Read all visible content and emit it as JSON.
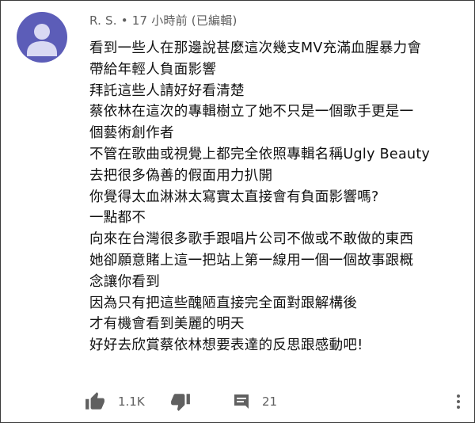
{
  "comment": {
    "author": "R. S.",
    "separator": "•",
    "timestamp": "17 小時前 (已編輯)",
    "lines": [
      "看到一些人在那邊說甚麼這次幾支MV充滿血腥暴力會",
      "帶給年輕人負面影響",
      "拜託這些人請好好看清楚",
      "蔡依林在這次的專輯樹立了她不只是一個歌手更是一",
      "個藝術創作者",
      "不管在歌曲或視覺上都完全依照專輯名稱Ugly Beauty",
      "去把很多偽善的假面用力扒開",
      "你覺得太血淋淋太寫實太直接會有負面影響嗎?",
      "一點都不",
      "向來在台灣很多歌手跟唱片公司不做或不敢做的東西",
      "她卻願意賭上這一把站上第一線用一個一個故事跟概",
      "念讓你看到",
      "因為只有把這些醜陋直接完全面對跟解構後",
      "才有機會看到美麗的明天",
      "好好去欣賞蔡依林想要表達的反思跟感動吧!"
    ]
  },
  "actions": {
    "like_count": "1.1K",
    "reply_count": "21"
  },
  "icons": {
    "avatar": "default-user-avatar",
    "like": "thumbs-up-icon",
    "dislike": "thumbs-down-icon",
    "reply": "comment-icon",
    "more": "more-vertical-icon"
  },
  "colors": {
    "avatar_bg": "#5c5db8",
    "avatar_figure": "#d9d9f3",
    "text_primary": "#111111",
    "text_secondary": "#606060",
    "icon": "#606060"
  }
}
